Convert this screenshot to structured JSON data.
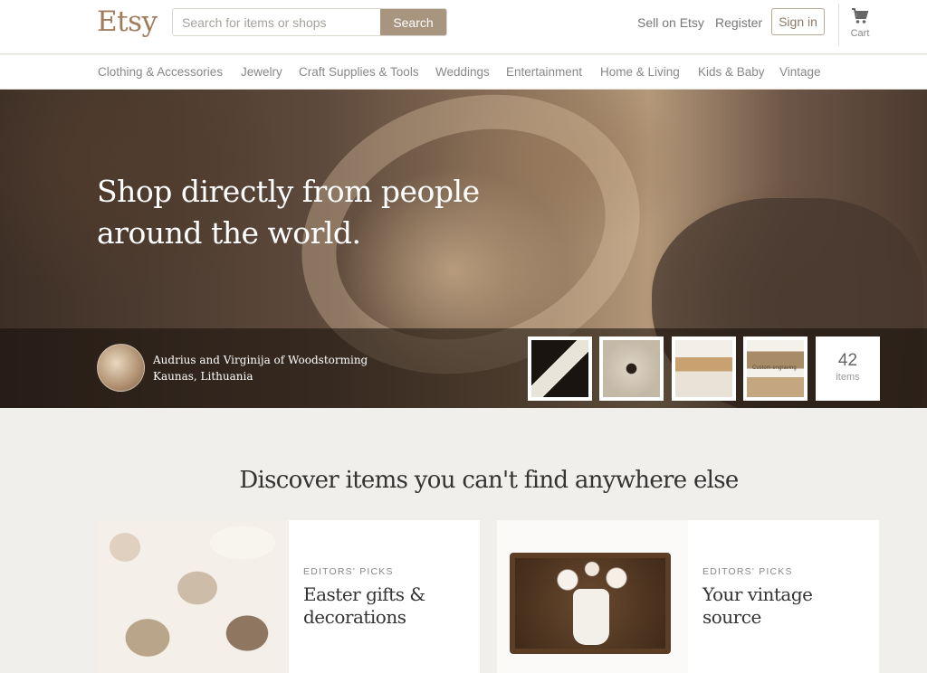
{
  "header": {
    "logo": "Etsy",
    "search_placeholder": "Search for items or shops",
    "search_button": "Search",
    "sell_link": "Sell on Etsy",
    "register_link": "Register",
    "signin_button": "Sign in",
    "cart_label": "Cart"
  },
  "categories": [
    "Clothing & Accessories",
    "Jewelry",
    "Craft Supplies & Tools",
    "Weddings",
    "Entertainment",
    "Home & Living",
    "Kids & Baby",
    "Vintage"
  ],
  "hero": {
    "headline_line1": "Shop directly from people",
    "headline_line2": "around the world.",
    "seller_name": "Audrius and Virginija of Woodstorming",
    "seller_location": "Kaunas, Lithuania",
    "thumb_caption": "Custom engraving",
    "items_count": "42",
    "items_label": "items"
  },
  "discover": {
    "title": "Discover items you can't find anywhere else",
    "cards": [
      {
        "eyebrow": "EDITORS' PICKS",
        "title": "Easter gifts & decorations"
      },
      {
        "eyebrow": "EDITORS' PICKS",
        "title": "Your vintage source"
      }
    ]
  },
  "colors": {
    "brand": "#a07c5c",
    "search_button": "#a8957f",
    "page_background": "#f1efeb"
  }
}
